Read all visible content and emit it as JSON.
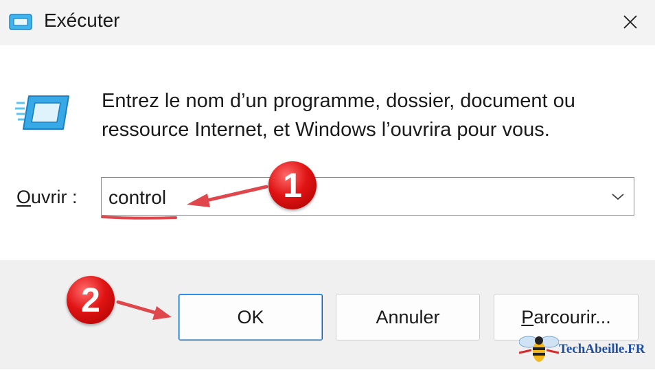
{
  "window": {
    "title": "Exécuter",
    "close_icon": "close-icon"
  },
  "dialog": {
    "description_line1": "Entrez le nom d’un programme, dossier, document ou",
    "description_line2": "ressource Internet, et Windows l’ouvrira pour vous.",
    "open_label_mnemonic": "O",
    "open_label_rest": "uvrir :",
    "open_value": "control"
  },
  "buttons": {
    "ok": "OK",
    "cancel": "Annuler",
    "browse_mnemonic": "P",
    "browse_rest": "arcourir..."
  },
  "annotations": {
    "step1": "1",
    "step2": "2",
    "badge_color": "#e01414",
    "arrow_color": "#e0474c"
  },
  "watermark": {
    "text": "TechAbeille.FR"
  },
  "colors": {
    "titlebar": "#f3f3f3",
    "footer": "#f0f0f0",
    "accent": "#005fb8",
    "run_icon": "#2aa0e0"
  }
}
